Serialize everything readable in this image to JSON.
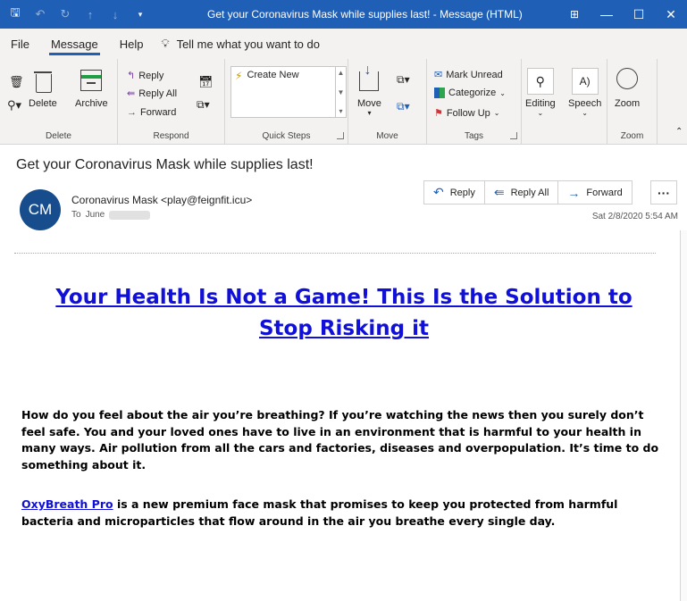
{
  "titlebar": {
    "title": "Get your Coronavirus Mask while supplies last!  -  Message (HTML)",
    "accent": "#1f5fb6"
  },
  "menu": {
    "file": "File",
    "message": "Message",
    "help": "Help",
    "search_placeholder": "Tell me what you want to do"
  },
  "ribbon": {
    "delete_group": {
      "delete": "Delete",
      "archive": "Archive",
      "label": "Delete"
    },
    "respond_group": {
      "reply": "Reply",
      "reply_all": "Reply All",
      "forward": "Forward",
      "label": "Respond"
    },
    "quicksteps_group": {
      "create_new": "Create New",
      "label": "Quick Steps"
    },
    "move_group": {
      "move": "Move",
      "label": "Move"
    },
    "tags_group": {
      "mark_unread": "Mark Unread",
      "categorize": "Categorize",
      "follow_up": "Follow Up",
      "label": "Tags"
    },
    "editing": "Editing",
    "speech": "Speech",
    "zoom": "Zoom",
    "zoom_label": "Zoom"
  },
  "message": {
    "subject": "Get your Coronavirus Mask while supplies last!",
    "avatar_initials": "CM",
    "avatar_color": "#174d8c",
    "sender": "Coronavirus Mask <play@feignfit.icu>",
    "to_label": "To",
    "to_name": "June",
    "datetime": "Sat 2/8/2020 5:54 AM",
    "actions": {
      "reply": "Reply",
      "reply_all": "Reply All",
      "forward": "Forward",
      "more": "···"
    }
  },
  "body": {
    "headline": "Your Health Is Not a Game! This Is the Solution to Stop Risking it",
    "paragraph1": "How do you feel about the air you’re breathing? If you’re watching the news then you surely don’t feel safe. You and your loved ones have to live in an environment that is harmful to your health in many ways. Air pollution from all the cars and factories, diseases and overpopulation. It’s time to do something about it.",
    "link_text": "OxyBreath Pro",
    "paragraph2_rest": " is a new premium face mask that promises to keep you protected from harmful bacteria and microparticles that flow around in the air you breathe every single day.",
    "link_color": "#1010d9"
  }
}
